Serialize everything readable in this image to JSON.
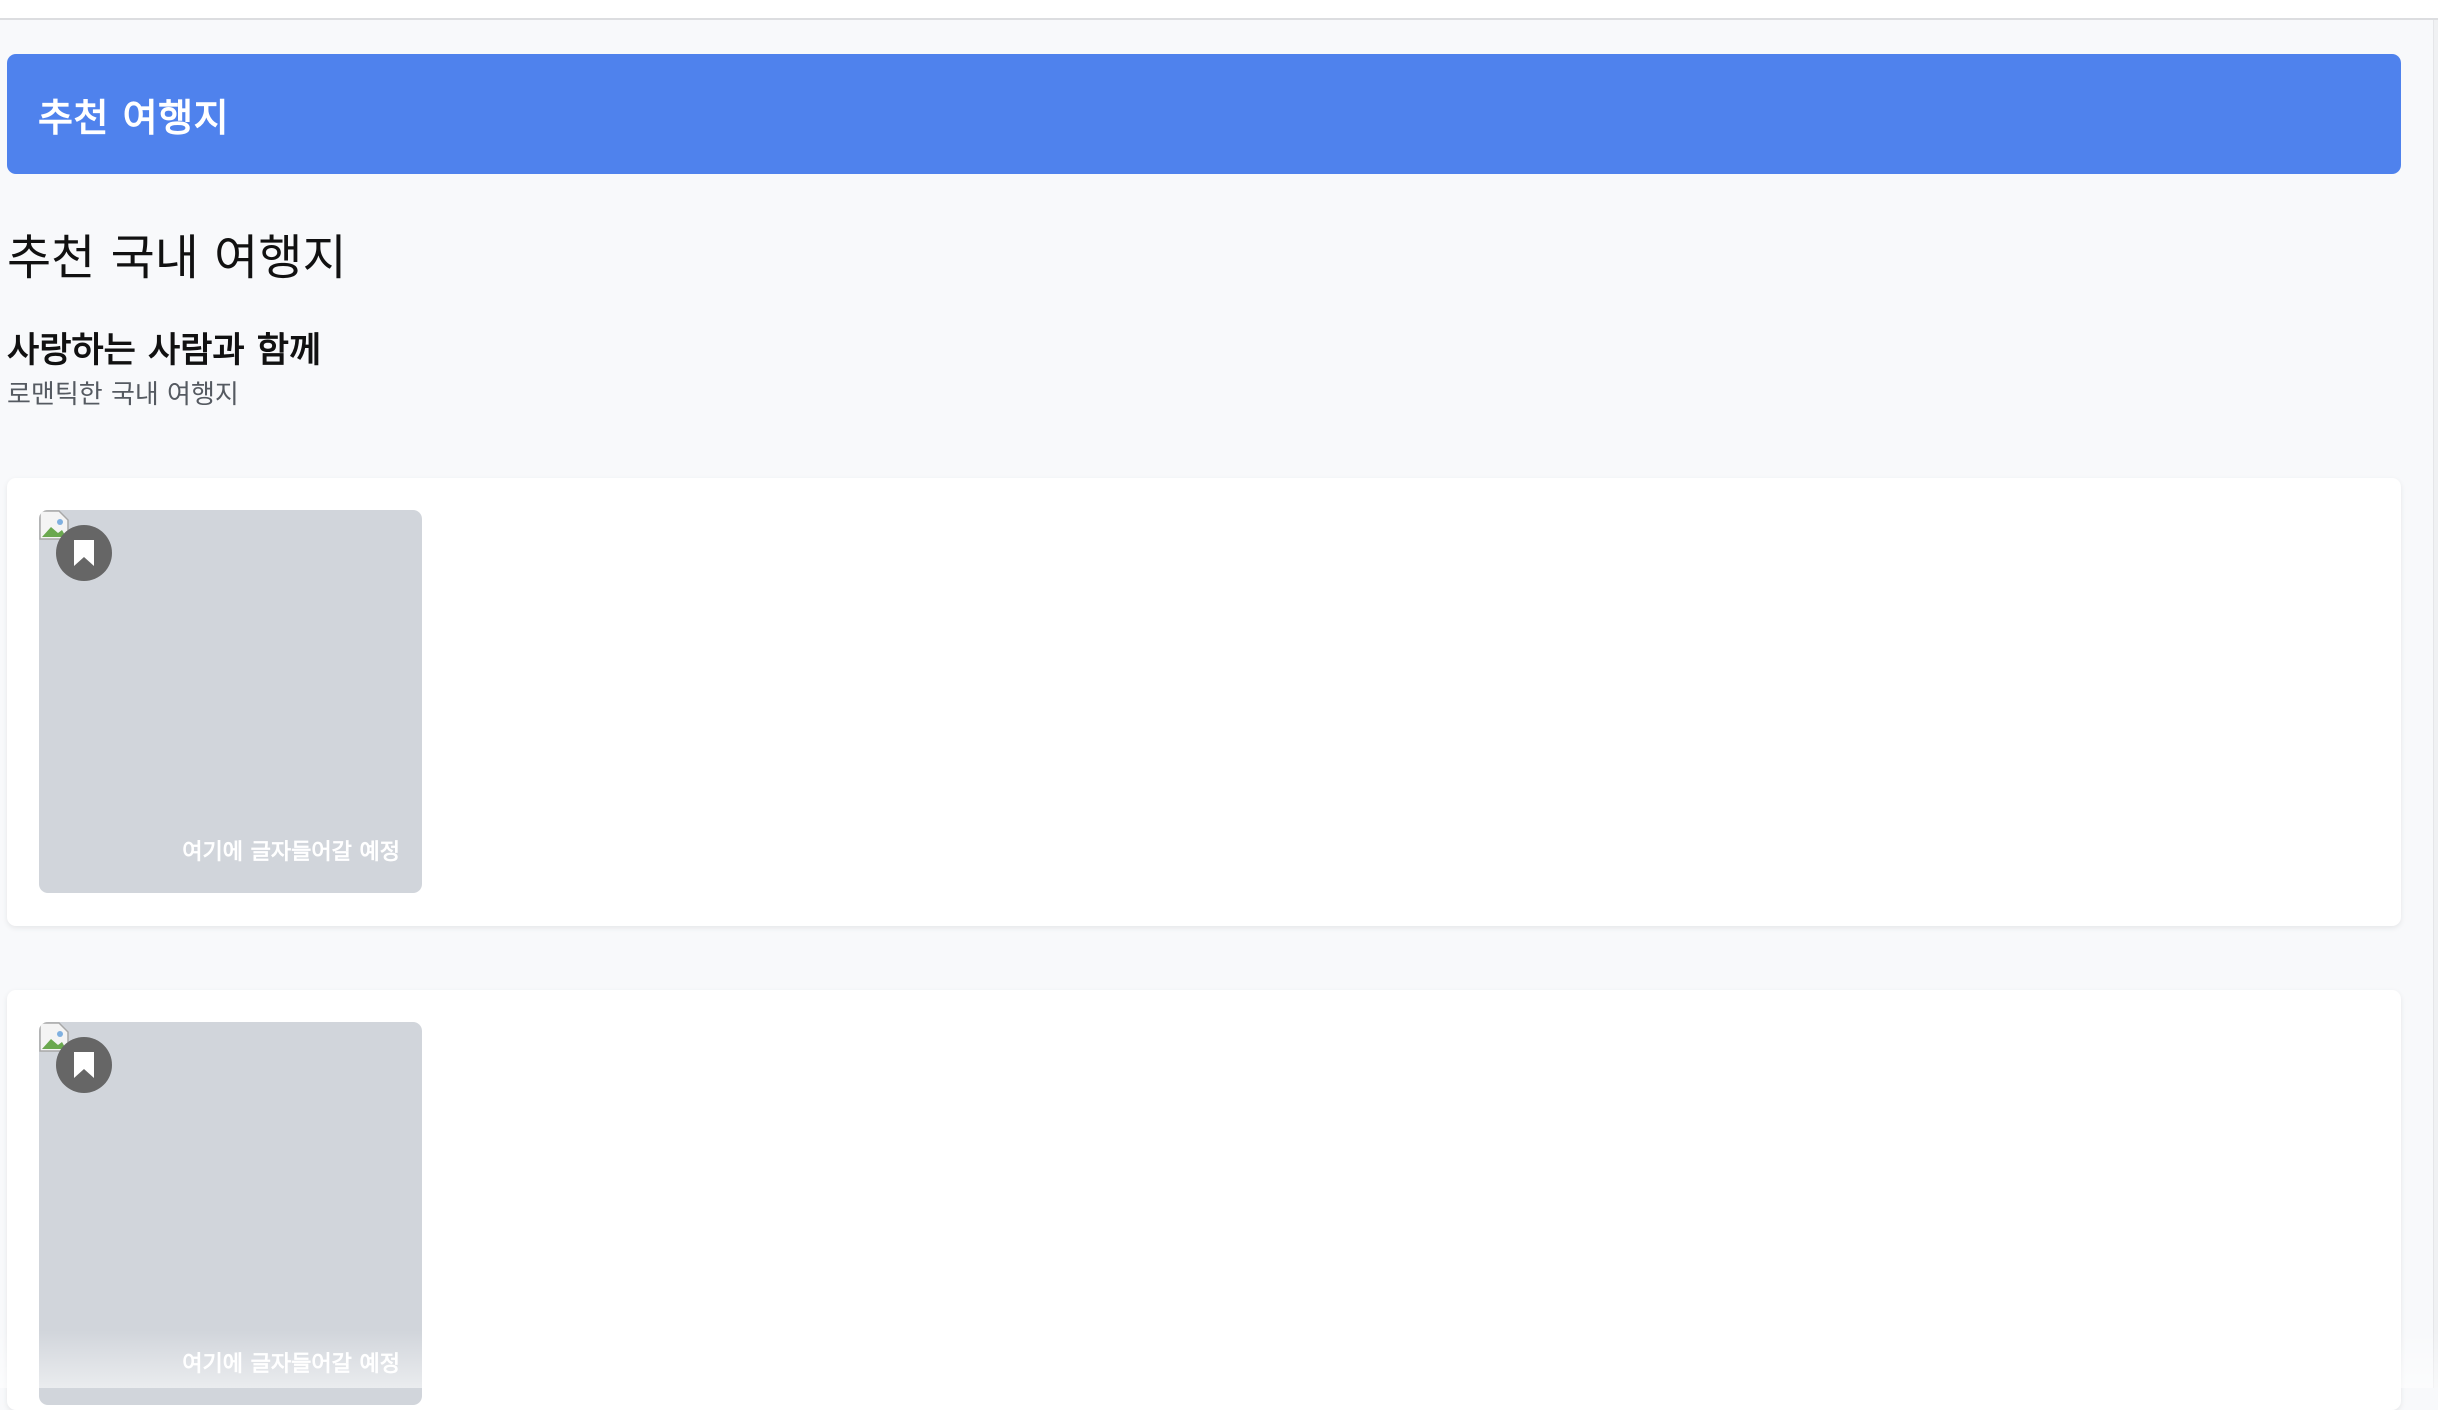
{
  "header": {
    "title": "추천 여행지"
  },
  "section": {
    "title": "추천 국내 여행지"
  },
  "group": {
    "title": "사랑하는 사람과 함께",
    "subtitle": "로맨틱한 국내 여행지"
  },
  "cards": [
    {
      "caption": "여기에 글자들어갈 예정",
      "bookmark_icon": "bookmark-icon"
    },
    {
      "caption": "여기에 글자들어갈 예정",
      "bookmark_icon": "bookmark-icon"
    }
  ],
  "colors": {
    "header_bg": "#4f82ed",
    "page_bg": "#f8f9fb",
    "card_placeholder": "#d1d5db",
    "bookmark_bg": "#666666"
  }
}
